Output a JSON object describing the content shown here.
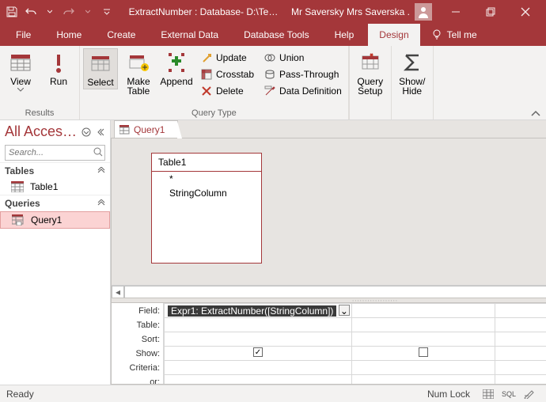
{
  "titlebar": {
    "app_title": "ExtractNumber : Database- D:\\Te…",
    "user_name": "Mr Saversky Mrs Saverska ."
  },
  "menu": {
    "file": "File",
    "home": "Home",
    "create": "Create",
    "external": "External Data",
    "dbtools": "Database Tools",
    "help": "Help",
    "design": "Design",
    "tellme": "Tell me"
  },
  "ribbon": {
    "view": "View",
    "run": "Run",
    "results_group": "Results",
    "select": "Select",
    "make_table": "Make\nTable",
    "append": "Append",
    "update": "Update",
    "crosstab": "Crosstab",
    "delete": "Delete",
    "union": "Union",
    "passthrough": "Pass-Through",
    "datadef": "Data Definition",
    "querytype_group": "Query Type",
    "query_setup": "Query\nSetup",
    "show_hide": "Show/\nHide"
  },
  "nav": {
    "title": "All Acces…",
    "search_placeholder": "Search...",
    "group_tables": "Tables",
    "item_table1": "Table1",
    "group_queries": "Queries",
    "item_query1": "Query1"
  },
  "doc": {
    "tab_label": "Query1",
    "tablebox_title": "Table1",
    "tablebox_star": "*",
    "tablebox_col": "StringColumn"
  },
  "grid": {
    "labels": {
      "field": "Field:",
      "table": "Table:",
      "sort": "Sort:",
      "show": "Show:",
      "criteria": "Criteria:",
      "or": "or:"
    },
    "field_expr": "Expr1: ExtractNumber([StringColumn])"
  },
  "status": {
    "ready": "Ready",
    "numlock": "Num Lock",
    "sql": "SQL"
  }
}
